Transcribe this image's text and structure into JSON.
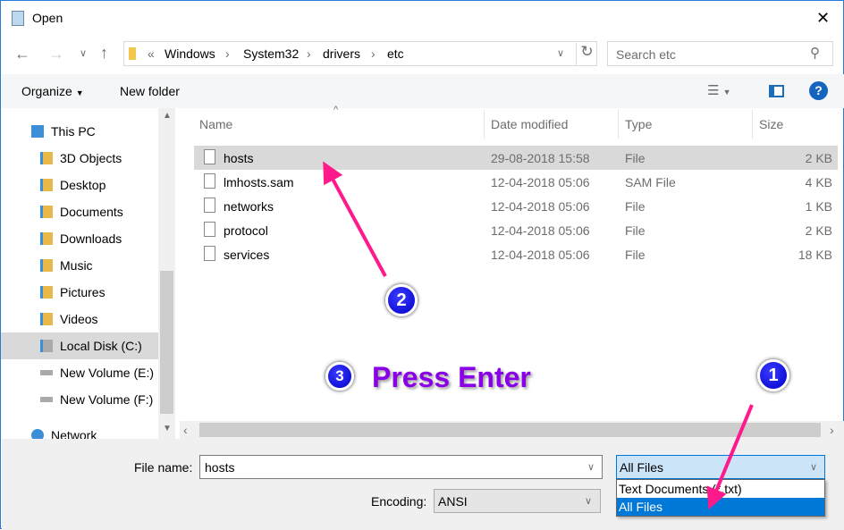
{
  "window": {
    "title": "Open",
    "close": "✕"
  },
  "address": {
    "overflow": "«",
    "crumbs": [
      "Windows",
      "System32",
      "drivers",
      "etc"
    ],
    "search_placeholder": "Search etc"
  },
  "toolbar": {
    "organize": "Organize",
    "new_folder": "New folder",
    "help": "?"
  },
  "nav": {
    "items": [
      {
        "label": "This PC"
      },
      {
        "label": "3D Objects"
      },
      {
        "label": "Desktop"
      },
      {
        "label": "Documents"
      },
      {
        "label": "Downloads"
      },
      {
        "label": "Music"
      },
      {
        "label": "Pictures"
      },
      {
        "label": "Videos"
      },
      {
        "label": "Local Disk (C:)",
        "selected": true
      },
      {
        "label": "New Volume (E:)"
      },
      {
        "label": "New Volume (F:)"
      },
      {
        "label": "Network"
      }
    ]
  },
  "columns": {
    "name": "Name",
    "date": "Date modified",
    "type": "Type",
    "size": "Size"
  },
  "files": [
    {
      "name": "hosts",
      "date": "29-08-2018 15:58",
      "type": "File",
      "size": "2 KB",
      "selected": true
    },
    {
      "name": "lmhosts.sam",
      "date": "12-04-2018 05:06",
      "type": "SAM File",
      "size": "4 KB"
    },
    {
      "name": "networks",
      "date": "12-04-2018 05:06",
      "type": "File",
      "size": "1 KB"
    },
    {
      "name": "protocol",
      "date": "12-04-2018 05:06",
      "type": "File",
      "size": "2 KB"
    },
    {
      "name": "services",
      "date": "12-04-2018 05:06",
      "type": "File",
      "size": "18 KB"
    }
  ],
  "bottom": {
    "file_name_label": "File name:",
    "file_name_value": "hosts",
    "filter_value": "All Files",
    "filter_options": [
      "Text Documents (*.txt)",
      "All Files"
    ],
    "encoding_label": "Encoding:",
    "encoding_value": "ANSI"
  },
  "annotations": {
    "step1": "1",
    "step2": "2",
    "step3": "3",
    "instruction": "Press Enter",
    "arrow_color": "#ff1a8c",
    "text_color": "#8a00e6"
  }
}
